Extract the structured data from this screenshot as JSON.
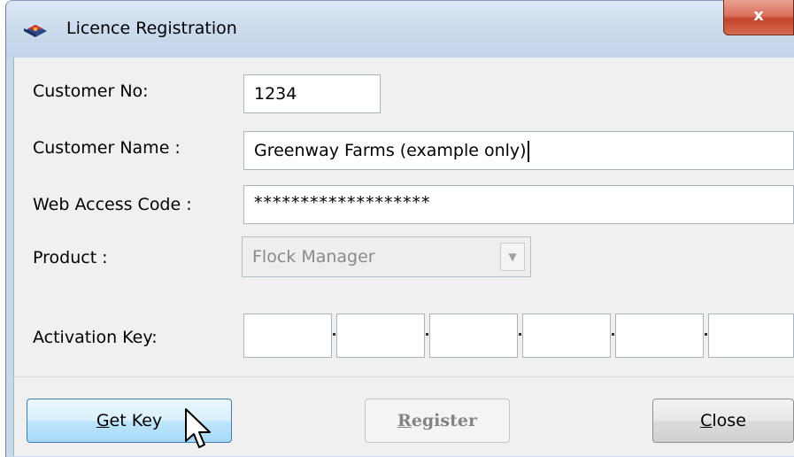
{
  "window": {
    "title": "Licence Registration",
    "close_glyph": "x"
  },
  "form": {
    "customer_no_label": "Customer No:",
    "customer_no_value": "1234",
    "customer_name_label": "Customer Name :",
    "customer_name_value": "Greenway Farms (example only)",
    "web_access_label": "Web Access Code :",
    "web_access_value": "*******************",
    "product_label": "Product :",
    "product_value": "Flock Manager",
    "activation_label": "Activation Key:"
  },
  "buttons": {
    "get_key_mnemonic": "G",
    "get_key_rest": "et Key",
    "register_mnemonic": "R",
    "register_rest": "egister",
    "close_mnemonic": "C",
    "close_rest": "lose"
  },
  "icons": {
    "app": "app-icon",
    "dropdown": "chevron-down-icon",
    "cursor": "mouse-pointer-icon"
  }
}
